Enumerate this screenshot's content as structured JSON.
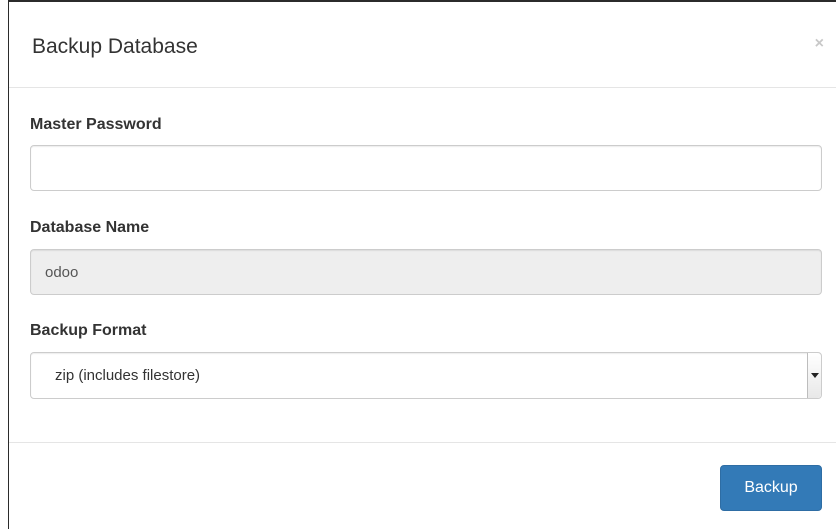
{
  "dialog": {
    "title": "Backup Database",
    "close_label": "×"
  },
  "form": {
    "master_password": {
      "label": "Master Password",
      "value": "",
      "placeholder": ""
    },
    "database_name": {
      "label": "Database Name",
      "value": "odoo"
    },
    "backup_format": {
      "label": "Backup Format",
      "selected": "zip (includes filestore)"
    }
  },
  "footer": {
    "backup_label": "Backup"
  },
  "colors": {
    "primary_button": "#337ab7",
    "disabled_field": "#eeeeee",
    "border": "#cccccc"
  }
}
